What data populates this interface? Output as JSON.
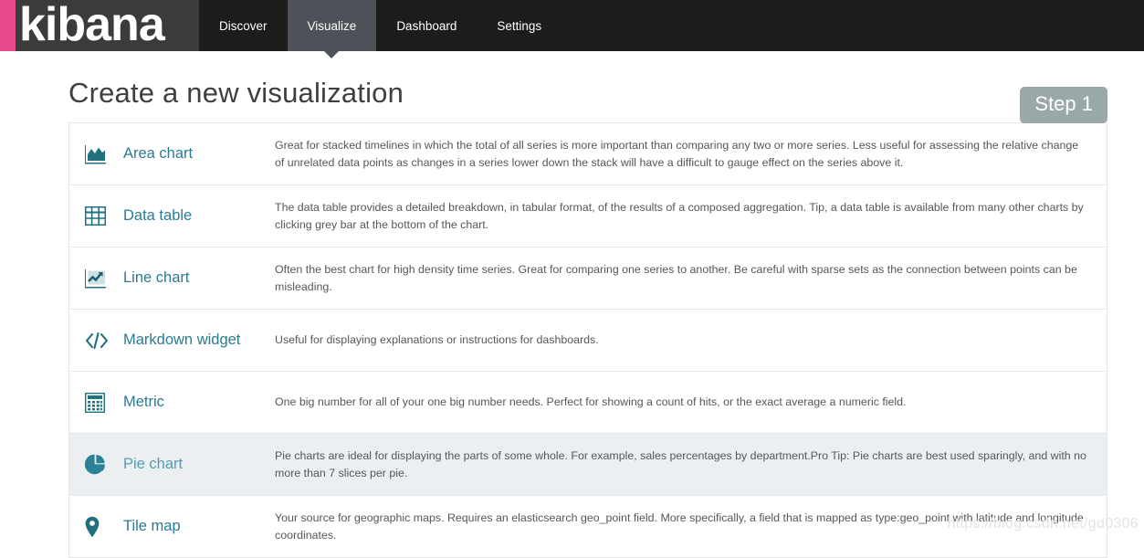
{
  "navbar": {
    "brand": "kibana",
    "brand_accent_color": "#e8488b",
    "items": [
      {
        "label": "Discover",
        "active": false
      },
      {
        "label": "Visualize",
        "active": true
      },
      {
        "label": "Dashboard",
        "active": false
      },
      {
        "label": "Settings",
        "active": false
      }
    ]
  },
  "header": {
    "title": "Create a new visualization",
    "step_badge": "Step 1",
    "step_badge_color": "#9aa8a8"
  },
  "viz_types": [
    {
      "icon": "area-chart-icon",
      "name": "Area chart",
      "description": "Great for stacked timelines in which the total of all series is more important than comparing any two or more series. Less useful for assessing the relative change of unrelated data points as changes in a series lower down the stack will have a difficult to gauge effect on the series above it.",
      "hovered": false
    },
    {
      "icon": "data-table-icon",
      "name": "Data table",
      "description": "The data table provides a detailed breakdown, in tabular format, of the results of a composed aggregation. Tip, a data table is available from many other charts by clicking grey bar at the bottom of the chart.",
      "hovered": false
    },
    {
      "icon": "line-chart-icon",
      "name": "Line chart",
      "description": "Often the best chart for high density time series. Great for comparing one series to another. Be careful with sparse sets as the connection between points can be misleading.",
      "hovered": false
    },
    {
      "icon": "markdown-code-icon",
      "name": "Markdown widget",
      "description": "Useful for displaying explanations or instructions for dashboards.",
      "hovered": false
    },
    {
      "icon": "calculator-icon",
      "name": "Metric",
      "description": "One big number for all of your one big number needs. Perfect for showing a count of hits, or the exact average a numeric field.",
      "hovered": false
    },
    {
      "icon": "pie-chart-icon",
      "name": "Pie chart",
      "description": "Pie charts are ideal for displaying the parts of some whole. For example, sales percentages by department.Pro Tip: Pie charts are best used sparingly, and with no more than 7 slices per pie.",
      "hovered": true
    },
    {
      "icon": "map-marker-icon",
      "name": "Tile map",
      "description": "Your source for geographic maps. Requires an elasticsearch geo_point field. More specifically, a field that is mapped as type:geo_point with latitude and longitude coordinates.",
      "hovered": false
    }
  ],
  "watermark": "https://blog.csdn.net/gd0306",
  "theme": {
    "nav_background": "#1c1c1c",
    "nav_active_background": "#4c5258",
    "brand_background": "#3b3b3b",
    "link_color": "#2b7b92",
    "icon_color": "#217080",
    "row_hover_background": "#eceff1",
    "border_color": "#e4e6e8",
    "description_color": "#55575a"
  }
}
